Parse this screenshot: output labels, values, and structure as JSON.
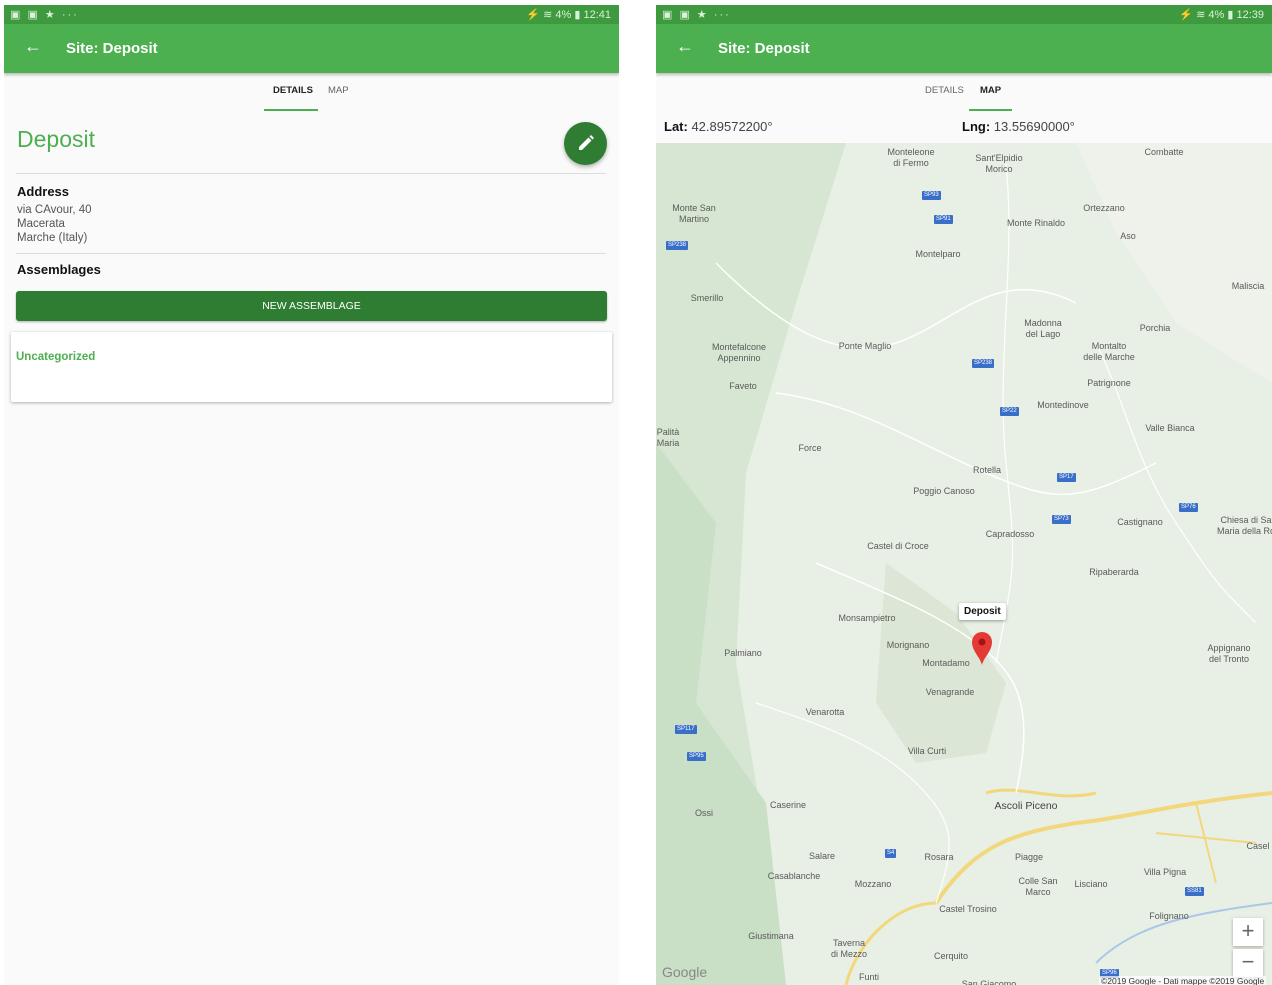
{
  "left_screen": {
    "status": {
      "icons": "▣ ▣ ★ ···",
      "right": "⚡ ≋ 4% ▮ 12:41"
    },
    "appbar": {
      "back_icon": "arrow-left-icon",
      "title": "Site: Deposit"
    },
    "tabs": [
      {
        "label": "DETAILS",
        "active": true
      },
      {
        "label": "MAP",
        "active": false
      }
    ],
    "heading": "Deposit",
    "edit_icon": "pencil-icon",
    "address": {
      "title": "Address",
      "lines": [
        "via CAvour, 40",
        "Macerata",
        "Marche (Italy)"
      ]
    },
    "assemblages": {
      "title": "Assemblages",
      "new_button": "NEW ASSEMBLAGE",
      "items": [
        "Uncategorized"
      ]
    }
  },
  "right_screen": {
    "status": {
      "icons": "▣ ▣ ★ ···",
      "right": "⚡ ≋ 4% ▮ 12:39"
    },
    "appbar": {
      "back_icon": "arrow-left-icon",
      "title": "Site: Deposit"
    },
    "tabs": [
      {
        "label": "DETAILS",
        "active": false
      },
      {
        "label": "MAP",
        "active": true
      }
    ],
    "lat_label": "Lat:",
    "lat_value": " 42.89572200°",
    "lng_label": "Lng:",
    "lng_value": " 13.55690000°",
    "map": {
      "marker_label": "Deposit",
      "zoom_in": "+",
      "zoom_out": "−",
      "google": "Google",
      "copyright": "©2019 Google - Dati mappe ©2019 Google",
      "places": [
        "Monteleone\ndi Fermo",
        "Sant'Elpidio\nMorico",
        "Combatte",
        "Monte San\nMartino",
        "Monte Rinaldo",
        "Ortezzano",
        "Aso",
        "Montelparo",
        "Smerillo",
        "Maliscia",
        "Madonna\ndel Lago",
        "Porchia",
        "Montefalcone\nAppennino",
        "Ponte Maglio",
        "Montalto\ndelle Marche",
        "Faveto",
        "Patrignone",
        "Montedinove",
        "Valle Bianca",
        "Force",
        "Rotella",
        "Poggio Canoso",
        "Castignano",
        "Chiesa di Sa\nMaria della Ro",
        "Capradosso",
        "Castel di Croce",
        "Ripaberarda",
        "Monsampietro",
        "Morignano",
        "Palmiano",
        "Montadamo",
        "Appignano\ndel Tronto",
        "Venagrande",
        "Venarotta",
        "Villa Curti",
        "Ossi",
        "Caserine",
        "Ascoli Piceno",
        "Salare",
        "Rosara",
        "Piagge",
        "Casablanche",
        "Mozzano",
        "Colle San\nMarco",
        "Lisciano",
        "Villa Pigna",
        "Castel Trosino",
        "Folignano",
        "Giustimana",
        "Taverna\ndi Mezzo",
        "Cerquito",
        "Funti",
        "San Giacomo",
        "Casel",
        "Palità\nMaria"
      ],
      "shields": [
        "SP93",
        "SP91",
        "SP238",
        "SP238",
        "SP22",
        "SP17",
        "SP73",
        "SP76",
        "SP117",
        "SP95",
        "S4",
        "SS81",
        "SP96"
      ]
    }
  }
}
